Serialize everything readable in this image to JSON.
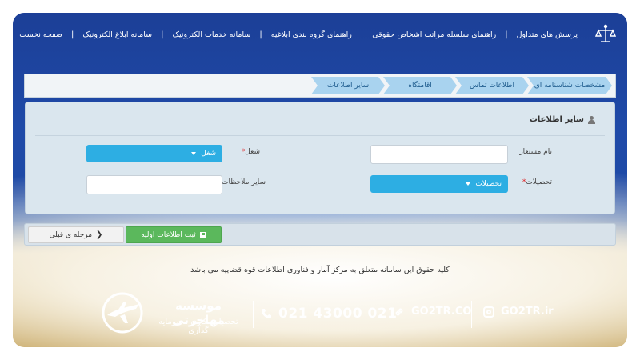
{
  "nav": {
    "items": [
      {
        "label": "صفحه نخست"
      },
      {
        "label": "سامانه ابلاغ الکترونیک"
      },
      {
        "label": "سامانه خدمات الکترونیک"
      },
      {
        "label": "راهنمای گروه بندی ابلاغیه"
      },
      {
        "label": "راهنمای سلسله مراتب اشخاص حقوقی"
      },
      {
        "label": "پرسش های متداول"
      }
    ],
    "separator": "|"
  },
  "steps": [
    {
      "label": "مشخصات شناسنامه ای"
    },
    {
      "label": "اطلاعات تماس"
    },
    {
      "label": "اقامتگاه"
    },
    {
      "label": "سایر اطلاعات"
    }
  ],
  "panel": {
    "title": "سایر اطلاعات",
    "fields": {
      "alias": {
        "label": "نام مستعار",
        "value": ""
      },
      "job": {
        "label": "شغل",
        "required": "*",
        "selected": "شغل"
      },
      "education": {
        "label": "تحصیلات",
        "required": "*",
        "selected": "تحصیلات"
      },
      "notes": {
        "label": "سایر ملاحظات",
        "value": ""
      }
    }
  },
  "actions": {
    "save_label": "ثبت اطلاعات اولیه",
    "prev_label": "مرحله ی قبلی"
  },
  "copyright": "کلیه حقوق این سامانه متعلق به مرکز آمار و فناوری اطلاعات قوه قضاییه می باشد",
  "footer": {
    "brand_name": "موسسه مهاجرتی",
    "brand_sub": "تحصیلی ،کاری ، سرمایه گذاری",
    "phone": "021 43000 021",
    "website": "GO2TR.CO",
    "instagram": "GO2TR.ir"
  },
  "colors": {
    "accent": "#2daee3",
    "step_tab": "#a9d3ef",
    "save_button": "#5bb85c",
    "header_blue": "#1f4aa8",
    "required": "#e02020"
  }
}
